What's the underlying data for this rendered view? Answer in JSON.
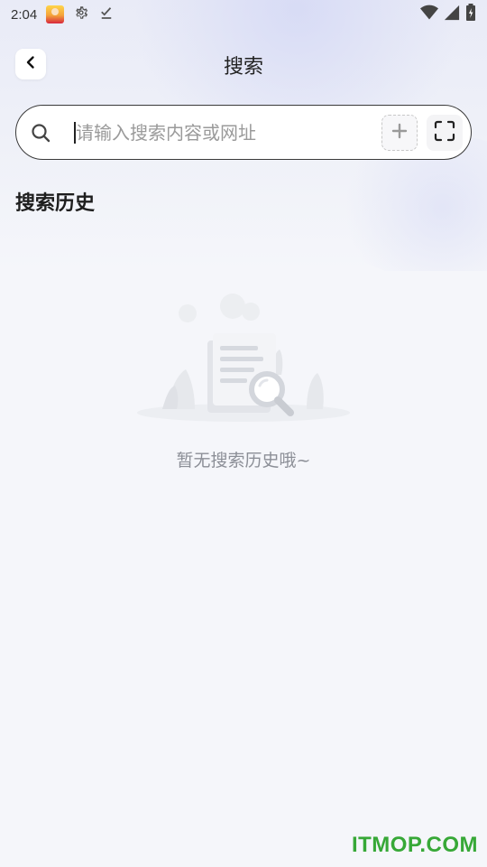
{
  "status_bar": {
    "time": "2:04",
    "icons": [
      "app-icon",
      "settings-icon",
      "download-done-icon",
      "wifi-icon",
      "signal-icon",
      "battery-icon"
    ]
  },
  "header": {
    "title": "搜索",
    "back_icon": "chevron-left-icon"
  },
  "search": {
    "placeholder": "请输入搜索内容或网址",
    "value": "",
    "add_icon": "plus-icon",
    "scan_icon": "scan-icon"
  },
  "history": {
    "title": "搜索历史",
    "items": [],
    "empty_text": "暂无搜索历史哦~"
  },
  "watermark": "ITMOP.COM",
  "colors": {
    "background": "#f5f6fa",
    "search_border": "#3a3a3a",
    "empty_text": "#8c8f97",
    "watermark": "#37a837"
  }
}
